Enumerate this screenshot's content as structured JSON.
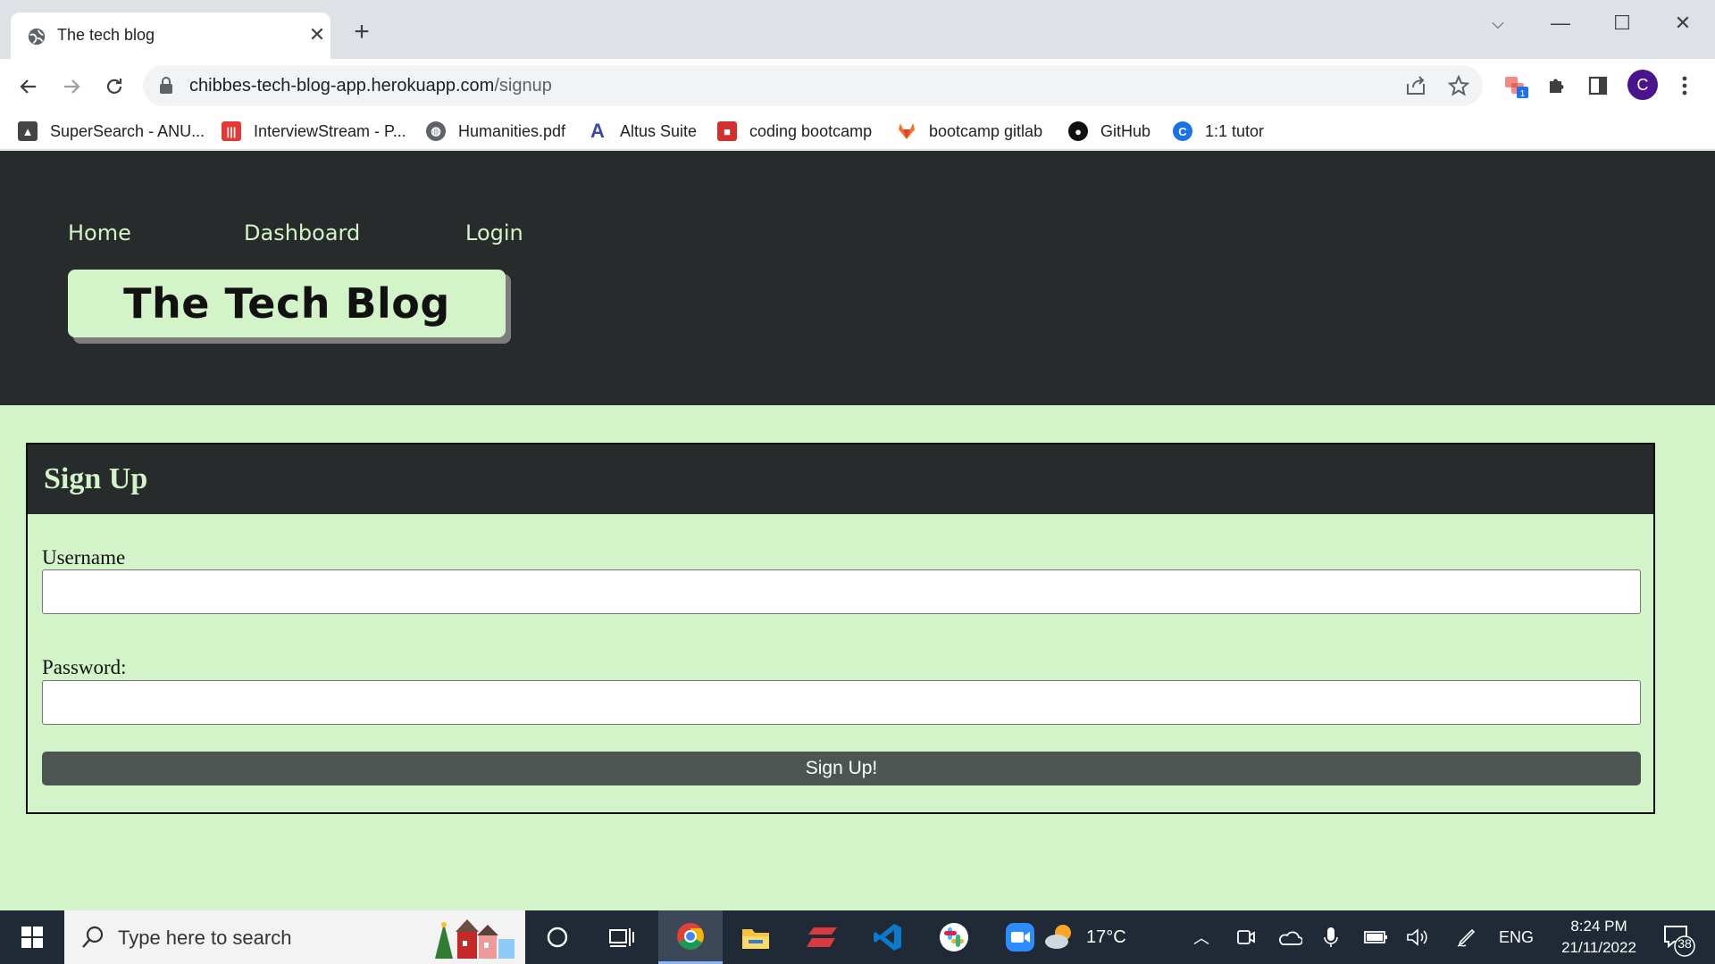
{
  "browser": {
    "tab_title": "The tech blog",
    "url_domain": "chibbes-tech-blog-app.herokuapp.com",
    "url_path": "/signup",
    "profile_initial": "C",
    "extension_badge": "1",
    "bookmarks": [
      {
        "label": "SuperSearch - ANU...",
        "icon": "supersearch-icon"
      },
      {
        "label": "InterviewStream - P...",
        "icon": "interviewstream-icon"
      },
      {
        "label": "Humanities.pdf",
        "icon": "globe-icon"
      },
      {
        "label": "Altus Suite",
        "icon": "altus-icon"
      },
      {
        "label": "coding bootcamp",
        "icon": "bootcamp-icon"
      },
      {
        "label": "bootcamp gitlab",
        "icon": "gitlab-icon"
      },
      {
        "label": "GitHub",
        "icon": "github-icon"
      },
      {
        "label": "1:1 tutor",
        "icon": "tutor-icon"
      }
    ]
  },
  "site": {
    "nav": {
      "home": "Home",
      "dashboard": "Dashboard",
      "login": "Login"
    },
    "logo_text": "The Tech Blog"
  },
  "signup": {
    "title": "Sign Up",
    "username_label": "Username",
    "username_value": "",
    "password_label": "Password:",
    "password_value": "",
    "submit_label": "Sign Up!"
  },
  "taskbar": {
    "search_placeholder": "Type here to search",
    "weather": "17°C",
    "language": "ENG",
    "time": "8:24 PM",
    "date": "21/11/2022",
    "notification_count": "38"
  },
  "colors": {
    "page_bg": "#d3f3c8",
    "header_bg": "#272b2b",
    "button_bg": "#4d5553"
  }
}
